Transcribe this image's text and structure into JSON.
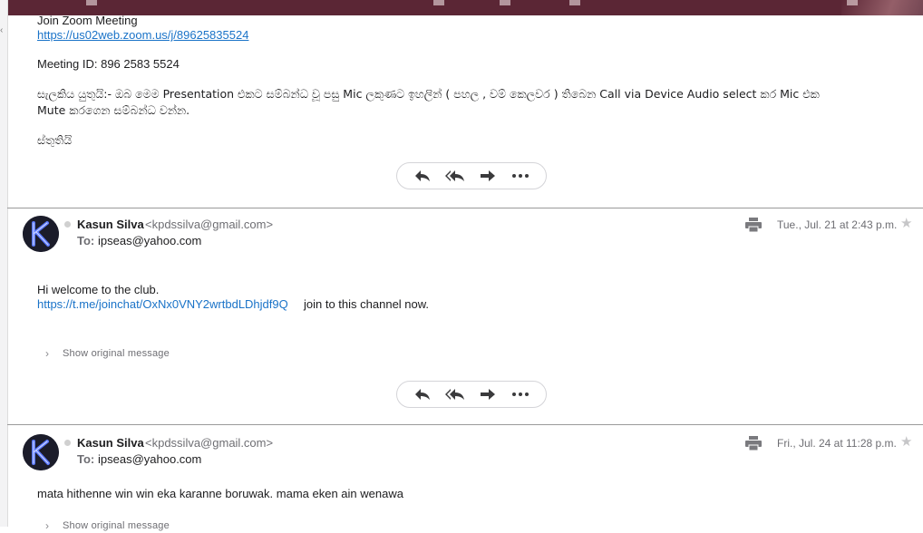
{
  "first_message": {
    "join_zoom": "Join Zoom Meeting",
    "zoom_link": "https://us02web.zoom.us/j/89625835524",
    "meeting_id": "Meeting ID: 896 2583 5524",
    "notice_line1": "සැලකිය යුතුයි:- ඔබ මෙම Presentation එකට සම්බන්ධ වූ පසු Mic ලකුණට ඉහලින්  ( පහල , වම් කෙලවර )  තිබෙන Call via Device Audio select කර Mic එක",
    "notice_line2": "Mute කරගෙන සම්බන්ධ වන්න.",
    "thanks": "ස්තුතියි"
  },
  "messages": [
    {
      "avatar_letter": "K",
      "sender_name": "Kasun Silva",
      "sender_email": "<kpdssilva@gmail.com>",
      "to_label": "To:",
      "to_value": "ipseas@yahoo.com",
      "date": "Tue., Jul. 21 at 2:43 p.m.",
      "body_line1": "Hi welcome to the club.",
      "body_link": "https://t.me/joinchat/OxNx0VNY2wrtbdLDhjdf9Q",
      "body_after_link": "join to this channel now.",
      "show_original": "Show original message"
    },
    {
      "avatar_letter": "K",
      "sender_name": "Kasun Silva",
      "sender_email": "<kpdssilva@gmail.com>",
      "to_label": "To:",
      "to_value": "ipseas@yahoo.com",
      "date": "Fri., Jul. 24 at 11:28 p.m.",
      "body_line1": "mata hithenne win win eka karanne boruwak. mama eken ain wenawa",
      "show_original": "Show original message"
    }
  ],
  "icons": {
    "reply": "reply-icon",
    "reply_all": "reply-all-icon",
    "forward": "forward-icon",
    "more": "more-icon",
    "print": "print-icon",
    "star": "star-icon"
  },
  "colors": {
    "topbar": "#5b2635",
    "link": "#1a73c8",
    "avatar_ring": "#4a6cff"
  }
}
